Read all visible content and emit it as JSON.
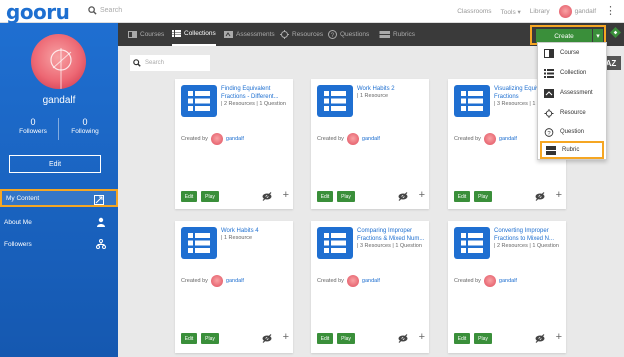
{
  "topbar": {
    "logo": "gooru",
    "search_placeholder": "Search",
    "nav": [
      "Classrooms",
      "Tools",
      "Library"
    ],
    "user": "gandalf"
  },
  "sidebar": {
    "username": "gandalf",
    "followers_count": "0",
    "followers_label": "Followers",
    "following_count": "0",
    "following_label": "Following",
    "edit_label": "Edit",
    "items": [
      {
        "label": "My Content",
        "icon": "content-icon"
      },
      {
        "label": "About Me",
        "icon": "person-icon"
      },
      {
        "label": "Followers",
        "icon": "network-icon"
      }
    ]
  },
  "tabs": [
    "Courses",
    "Collections",
    "Assessments",
    "Resources",
    "Questions",
    "Rubrics"
  ],
  "create_label": "Create",
  "content_search_placeholder": "Search",
  "sort_label": "AZ",
  "create_menu": [
    "Course",
    "Collection",
    "Assessment",
    "Resource",
    "Question",
    "Rubric"
  ],
  "cards": [
    {
      "title": "Finding Equivalent Fractions - Different...",
      "meta": "| 2 Resources | 1 Question",
      "created_by": "Created by",
      "author": "gandalf",
      "edit": "Edit",
      "play": "Play"
    },
    {
      "title": "Work Habits 2",
      "meta": "| 1 Resource",
      "created_by": "Created by",
      "author": "gandalf",
      "edit": "Edit",
      "play": "Play"
    },
    {
      "title": "Visualizing Equiva... Fractions",
      "meta": "| 3 Resources | 1 Question",
      "created_by": "Created by",
      "author": "gandalf",
      "edit": "Edit",
      "play": "Play"
    },
    {
      "title": "Work Habits 4",
      "meta": "| 1 Resource",
      "created_by": "Created by",
      "author": "gandalf",
      "edit": "Edit",
      "play": "Play"
    },
    {
      "title": "Comparing Improper Fractions & Mixed Num...",
      "meta": "| 3 Resources | 1 Question",
      "created_by": "Created by",
      "author": "gandalf",
      "edit": "Edit",
      "play": "Play"
    },
    {
      "title": "Converting Improper Fractions to Mixed N...",
      "meta": "| 2 Resources | 1 Question",
      "created_by": "Created by",
      "author": "gandalf",
      "edit": "Edit",
      "play": "Play"
    }
  ],
  "colors": {
    "brand_blue": "#1f6fd1",
    "green": "#3a8f3a",
    "highlight": "#f5a623",
    "tabbar": "#3a3a3a"
  }
}
